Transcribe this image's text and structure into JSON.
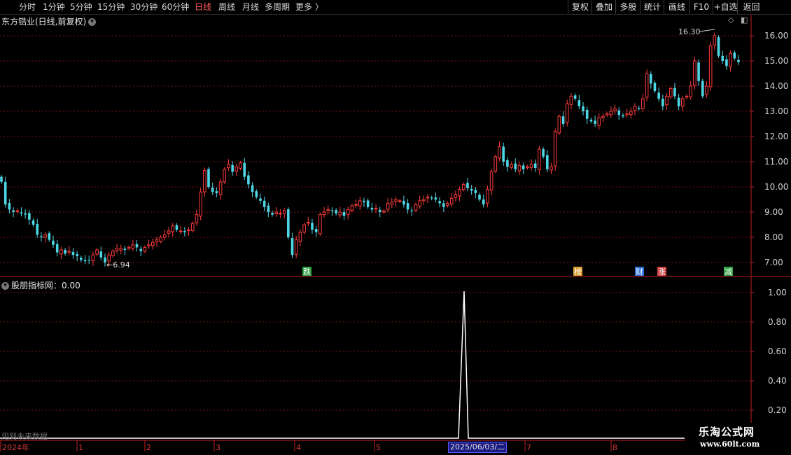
{
  "toolbar": {
    "periods": [
      "分时",
      "1分钟",
      "5分钟",
      "15分钟",
      "30分钟",
      "60分钟",
      "日线",
      "周线",
      "月线",
      "多周期",
      "更多 〉"
    ],
    "active": "日线",
    "right_buttons": [
      "复权",
      "叠加",
      "多股",
      "统计",
      "画线",
      "F10",
      "+自选",
      "返回"
    ]
  },
  "stock": {
    "title": "东方锆业(日线,前复权)"
  },
  "price_axis": [
    "16.00",
    "15.00",
    "14.00",
    "13.00",
    "12.00",
    "11.00",
    "10.00",
    "9.00",
    "8.00",
    "7.00"
  ],
  "annotations": {
    "high": "16.30",
    "low": "6.94"
  },
  "signals": [
    {
      "label": "跌",
      "color": "#2ea043"
    },
    {
      "label": "榜",
      "color": "#d89a2a"
    },
    {
      "label": "财",
      "color": "#2b6ed8"
    },
    {
      "label": "涨",
      "color": "#c83a3a"
    },
    {
      "label": "减",
      "color": "#2ea043"
    }
  ],
  "indicator": {
    "title": "股朋指标网：0.00",
    "axis": [
      "1.00",
      "0.80",
      "0.60",
      "0.40",
      "0.20"
    ]
  },
  "time_axis": [
    "2024年",
    "1",
    "2",
    "3",
    "4",
    "5",
    "7",
    "8"
  ],
  "highlight_date": "2025/06/03/二",
  "watermark": "用到未来数据",
  "logo": {
    "name": "乐淘公式网",
    "url": "www.60lt.com"
  },
  "colors": {
    "up": "#ff3b3b",
    "down": "#4dd7e6",
    "axis": "#c02020",
    "grid": "#7a1010"
  },
  "chart_data": {
    "type": "candlestick",
    "ylim": [
      6.6,
      16.6
    ],
    "closes": [
      10.2,
      9.3,
      9.1,
      9.0,
      9.05,
      8.95,
      8.9,
      8.7,
      8.5,
      8.1,
      8.0,
      8.1,
      7.9,
      7.7,
      7.4,
      7.5,
      7.35,
      7.45,
      7.3,
      7.25,
      7.1,
      7.05,
      7.1,
      7.3,
      7.5,
      7.2,
      7.0,
      7.3,
      7.45,
      7.55,
      7.55,
      7.5,
      7.6,
      7.7,
      7.6,
      7.45,
      7.6,
      7.7,
      7.8,
      7.9,
      8.0,
      8.1,
      8.25,
      8.45,
      8.3,
      8.25,
      8.2,
      8.3,
      8.55,
      8.9,
      9.8,
      10.65,
      10.0,
      9.8,
      9.75,
      10.2,
      10.7,
      10.9,
      10.6,
      10.8,
      10.95,
      10.4,
      10.1,
      9.8,
      9.6,
      9.45,
      9.2,
      9.0,
      8.9,
      9.0,
      8.95,
      9.05,
      8.0,
      7.3,
      7.9,
      8.2,
      8.5,
      8.6,
      8.3,
      8.2,
      8.9,
      9.0,
      9.1,
      9.05,
      8.95,
      9.0,
      8.85,
      9.1,
      9.25,
      9.3,
      9.45,
      9.4,
      9.2,
      9.1,
      9.15,
      9.0,
      9.05,
      9.35,
      9.4,
      9.5,
      9.45,
      9.3,
      9.1,
      9.05,
      9.3,
      9.45,
      9.5,
      9.6,
      9.55,
      9.5,
      9.35,
      9.2,
      9.35,
      9.55,
      9.7,
      9.9,
      10.1,
      9.95,
      9.85,
      9.75,
      9.5,
      9.3,
      9.9,
      10.6,
      11.2,
      11.6,
      11.0,
      10.8,
      10.9,
      10.7,
      10.85,
      10.7,
      10.8,
      10.9,
      10.75,
      11.5,
      11.2,
      10.7,
      10.8,
      12.2,
      12.8,
      12.5,
      13.3,
      13.6,
      13.5,
      13.2,
      13.0,
      12.7,
      12.6,
      12.5,
      12.75,
      12.8,
      12.9,
      13.0,
      13.1,
      12.85,
      12.8,
      12.9,
      13.0,
      13.2,
      13.1,
      13.5,
      14.5,
      14.1,
      13.8,
      13.5,
      13.2,
      13.6,
      13.9,
      13.6,
      13.2,
      13.5,
      13.6,
      14.0,
      15.0,
      14.2,
      13.6,
      14.0,
      15.6,
      16.0,
      15.2,
      15.0,
      14.8,
      15.3,
      15.1,
      14.95
    ]
  }
}
